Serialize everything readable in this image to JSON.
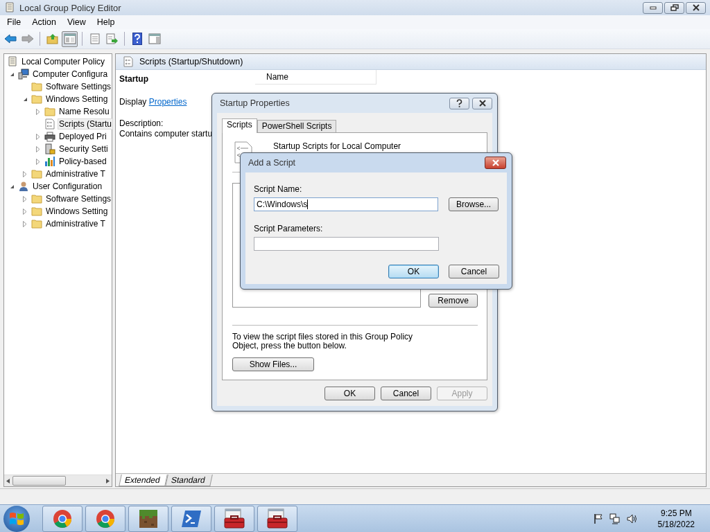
{
  "window": {
    "title": "Local Group Policy Editor"
  },
  "menu": [
    {
      "label": "File"
    },
    {
      "label": "Action"
    },
    {
      "label": "View"
    },
    {
      "label": "Help"
    }
  ],
  "toolbar": [
    [
      {
        "kind": "back",
        "disabled": false,
        "pressed": false
      },
      {
        "kind": "forward",
        "disabled": true,
        "pressed": false
      }
    ],
    [
      {
        "kind": "up",
        "disabled": false,
        "pressed": false
      },
      {
        "kind": "tree",
        "disabled": false,
        "pressed": true
      }
    ],
    [
      {
        "kind": "properties",
        "disabled": false,
        "pressed": false
      },
      {
        "kind": "export",
        "disabled": false,
        "pressed": false
      }
    ],
    [
      {
        "kind": "help",
        "disabled": false,
        "pressed": false
      },
      {
        "kind": "pane",
        "disabled": false,
        "pressed": false
      }
    ]
  ],
  "tree": [
    {
      "label": "Local Computer Policy",
      "kind": "policy",
      "selected": false,
      "children": [
        {
          "label": "Computer Configura",
          "kind": "computer",
          "expanded": true,
          "selected": false,
          "children": [
            {
              "label": "Software Settings",
              "kind": "folder",
              "selected": false
            },
            {
              "label": "Windows Setting",
              "kind": "folder",
              "expanded": true,
              "selected": false,
              "children": [
                {
                  "label": "Name Resolu",
                  "kind": "folder",
                  "expanded": false,
                  "selected": false
                },
                {
                  "label": "Scripts (Startu",
                  "kind": "script",
                  "selected": true
                },
                {
                  "label": "Deployed Pri",
                  "kind": "printer",
                  "expanded": false,
                  "selected": false
                },
                {
                  "label": "Security Setti",
                  "kind": "security",
                  "expanded": false,
                  "selected": false
                },
                {
                  "label": "Policy-based",
                  "kind": "chart",
                  "expanded": false,
                  "selected": false
                }
              ]
            },
            {
              "label": "Administrative T",
              "kind": "folder",
              "expanded": false,
              "selected": false
            }
          ]
        },
        {
          "label": "User Configuration",
          "kind": "user",
          "expanded": true,
          "selected": false,
          "children": [
            {
              "label": "Software Settings",
              "kind": "folder",
              "expanded": false,
              "selected": false
            },
            {
              "label": "Windows Setting",
              "kind": "folder",
              "expanded": false,
              "selected": false
            },
            {
              "label": "Administrative T",
              "kind": "folder",
              "expanded": false,
              "selected": false
            }
          ]
        }
      ]
    }
  ],
  "details": {
    "header": "Scripts (Startup/Shutdown)",
    "heading": "Startup",
    "display_label": "Display",
    "display_link": "Properties",
    "description_label": "Description:",
    "description": "Contains computer startu",
    "column_1": "Name"
  },
  "view_tabs": [
    {
      "label": "Extended",
      "selected": true
    },
    {
      "label": "Standard",
      "selected": false
    }
  ],
  "startup_dialog": {
    "title": "Startup Properties",
    "tabs": [
      {
        "label": "Scripts",
        "selected": true
      },
      {
        "label": "PowerShell Scripts",
        "selected": false
      }
    ],
    "heading": "Startup Scripts for Local Computer",
    "side_button": "Remove",
    "note": "To view the script files stored in this Group Policy Object, press the button below.",
    "show_files": "Show Files...",
    "buttons": [
      {
        "label": "OK",
        "disabled": false
      },
      {
        "label": "Cancel",
        "disabled": false
      },
      {
        "label": "Apply",
        "disabled": true
      }
    ]
  },
  "add_dialog": {
    "title": "Add a Script",
    "fields": [
      {
        "label": "Script Name:",
        "value": "C:\\Windows\\s",
        "focused": true,
        "button": "Browse..."
      },
      {
        "label": "Script Parameters:",
        "focused": false
      }
    ],
    "buttons": [
      {
        "label": "OK",
        "default": true
      },
      {
        "label": "Cancel",
        "default": false
      }
    ]
  },
  "taskbar": {
    "apps": [
      {
        "kind": "chrome"
      },
      {
        "kind": "chrome"
      },
      {
        "kind": "block"
      },
      {
        "kind": "powershell"
      },
      {
        "kind": "toolbox"
      },
      {
        "kind": "toolbox"
      }
    ],
    "time": "9:25 PM",
    "date": "5/18/2022"
  }
}
